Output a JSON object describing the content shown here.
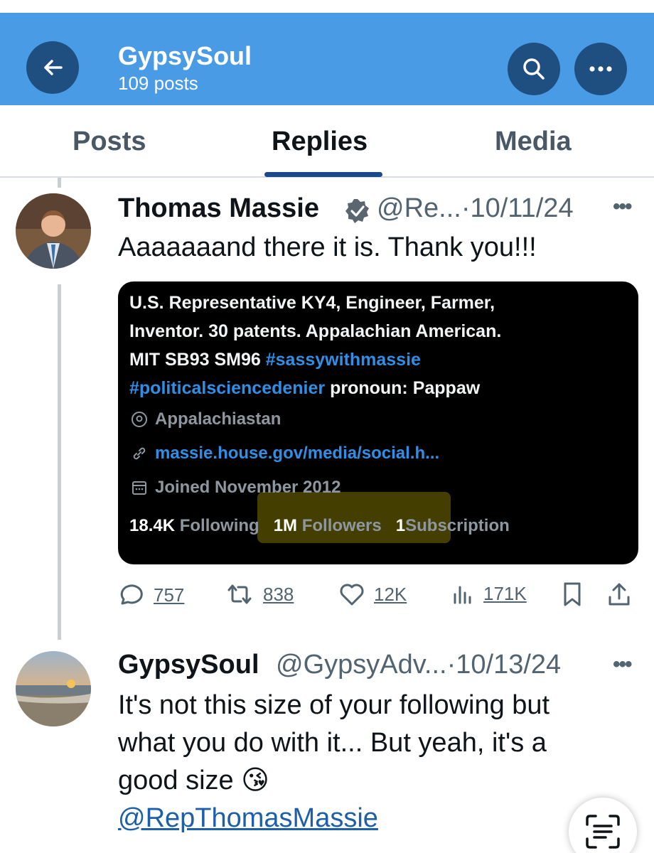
{
  "header": {
    "title": "GypsySoul",
    "subtitle": "109 posts",
    "bg_color": "#4a9be6"
  },
  "tabs": [
    {
      "label": "Posts",
      "active": false
    },
    {
      "label": "Replies",
      "active": true
    },
    {
      "label": "Media",
      "active": false
    }
  ],
  "tweet1": {
    "name": "Thomas Massie",
    "verified": true,
    "handle_date": "@Re...·10/11/24",
    "text": "Aaaaaaand there it is. Thank you!!!",
    "card": {
      "bio_line1": "U.S. Representative KY4, Engineer, Farmer,",
      "bio_line2": "Inventor. 30 patents. Appalachian American.",
      "bio_line3_plain": "MIT SB93 SM96 ",
      "bio_line3_tag": "#sassywithmassie",
      "bio_line4_tag": "#politicalsciencedenier",
      "bio_line4_plain": " pronoun: Pappaw",
      "location": "Appalachiastan",
      "link": "massie.house.gov/media/social.h...",
      "joined": "Joined November 2012",
      "following_count": "18.4K",
      "following_label": "Following",
      "followers_count": "1M",
      "followers_label": "Followers",
      "subscriptions_count": "1",
      "subscriptions_label": "Subscription"
    },
    "actions": {
      "replies": "757",
      "reposts": "838",
      "likes": "12K",
      "views": "171K"
    }
  },
  "tweet2": {
    "name": "GypsySoul",
    "handle_date": "@GypsyAdv...·10/13/24",
    "text_line1": "It's not this size of your following but",
    "text_line2": "what you do with it... But yeah, it's a",
    "text_line3": "good size 😘",
    "mention": "@RepThomasMassie"
  },
  "icons": [
    "back-arrow-icon",
    "search-icon",
    "more-icon",
    "verified-badge-icon",
    "location-icon",
    "link-icon",
    "calendar-icon",
    "reply-icon",
    "repost-icon",
    "like-icon",
    "views-icon",
    "bookmark-icon",
    "share-icon",
    "scan-text-icon"
  ]
}
